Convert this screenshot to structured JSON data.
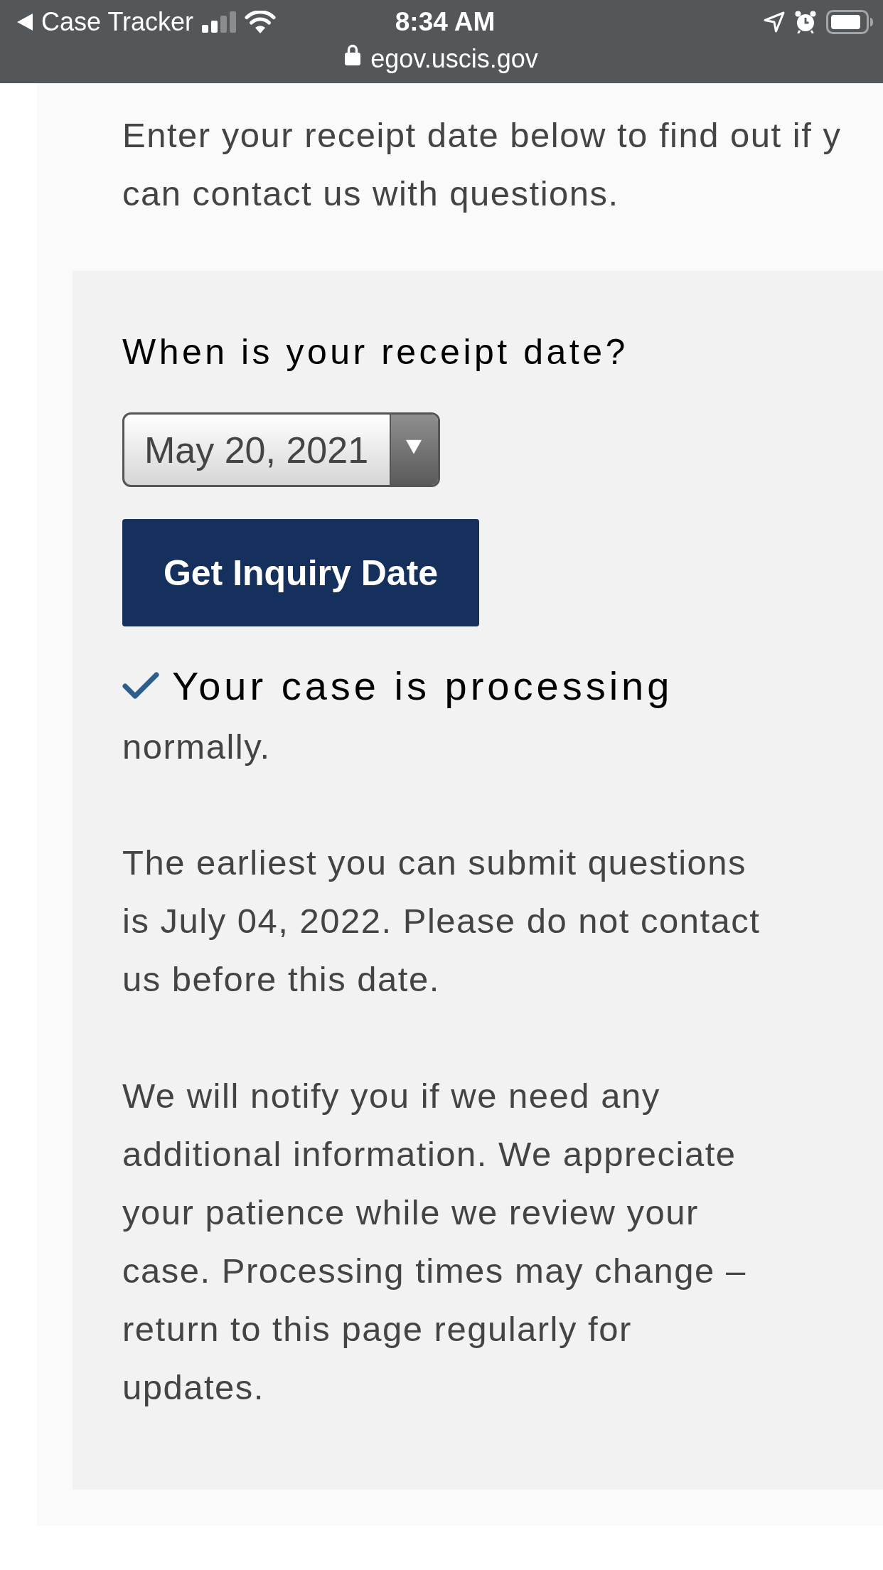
{
  "status_bar": {
    "back_label": "Case Tracker",
    "time": "8:34 AM",
    "url": "egov.uscis.gov"
  },
  "intro": "Enter your receipt date below to find out if y\ncan contact us with questions.",
  "form": {
    "question": "When is your receipt date?",
    "date_select": {
      "value": "May 20, 2021"
    },
    "submit_button": "Get Inquiry Date"
  },
  "result": {
    "status": "Your case is processing",
    "status_continued": "normally.",
    "paragraphs": [
      "The earliest you can submit questions is July 04, 2022. Please do not contact us before this date.",
      "We will notify you if we need any additional information. We appreciate your patience while we review your case. Processing times may change – return to this page regularly for updates."
    ]
  }
}
